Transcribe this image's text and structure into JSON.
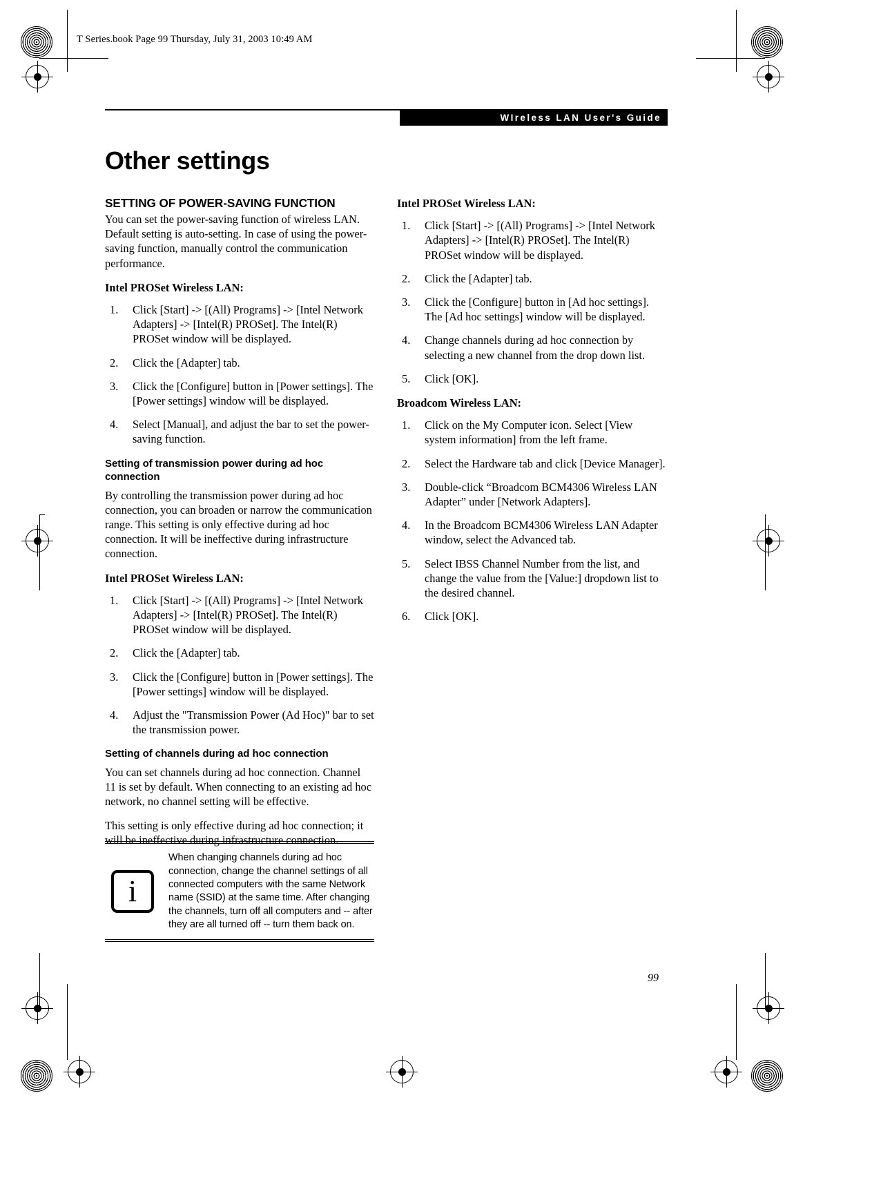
{
  "file_stamp": "T Series.book  Page 99  Thursday, July 31, 2003  10:49 AM",
  "running_head": "WIreless LAN User's Guide",
  "page_title": "Other settings",
  "folio": "99",
  "note": {
    "icon_glyph": "i",
    "text": "When changing channels during ad hoc connection, change the channel settings of all connected computers with the same Network name (SSID) at the same time. After changing the channels, turn off all computers and -- after they are all turned off -- turn them back on."
  },
  "left_column": {
    "section_heading": "SETTING OF POWER-SAVING FUNCTION",
    "intro": "You can set the power-saving function of wireless LAN. Default setting is auto-setting. In case of using the power-saving function, manually control the communication performance.",
    "lead_in_1": "Intel PROSet Wireless LAN:",
    "steps_1": [
      {
        "num": "1.",
        "text": "Click [Start] -> [(All) Programs] -> [Intel Network Adapters] -> [Intel(R) PROSet]. The Intel(R) PROSet window will be displayed."
      },
      {
        "num": "2.",
        "text": "Click the [Adapter] tab."
      },
      {
        "num": "3.",
        "text": "Click the [Configure] button in [Power settings]. The [Power settings] window will be displayed."
      },
      {
        "num": "4.",
        "text": "Select [Manual], and adjust the bar to set the power-saving function."
      }
    ],
    "sub_heading_1": "Setting of transmission power during ad hoc connection",
    "para_1": "By controlling the transmission power during ad hoc connection, you can broaden or narrow the communication range. This setting is only effective during ad hoc connection. It will be ineffective during infrastructure connection.",
    "lead_in_2": "Intel PROSet Wireless LAN:",
    "steps_2": [
      {
        "num": "1.",
        "text": "Click [Start] -> [(All) Programs] -> [Intel Network Adapters] -> [Intel(R) PROSet]. The Intel(R) PROSet window will be displayed."
      },
      {
        "num": "2.",
        "text": "Click the [Adapter] tab."
      },
      {
        "num": "3.",
        "text": "Click the [Configure] button in [Power settings]. The [Power settings] window will be displayed."
      },
      {
        "num": "4.",
        "text": "Adjust the \"Transmission Power (Ad Hoc)\" bar to set the transmission power."
      }
    ],
    "sub_heading_2": "Setting of channels during ad hoc connection",
    "para_2": "You can set channels during ad hoc connection. Channel 11 is set by default. When connecting to an existing ad hoc network, no channel setting will be effective.",
    "para_3": "This setting is only effective during ad hoc connection; it will be ineffective during infrastructure connection."
  },
  "right_column": {
    "lead_in_1": "Intel PROSet Wireless LAN:",
    "steps_1": [
      {
        "num": "1.",
        "text": "Click [Start] -> [(All) Programs] -> [Intel Network Adapters] -> [Intel(R) PROSet]. The Intel(R) PROSet window will be displayed."
      },
      {
        "num": "2.",
        "text": "Click the [Adapter] tab."
      },
      {
        "num": "3.",
        "text": "Click the [Configure] button in [Ad hoc settings]. The [Ad hoc settings] window will be displayed."
      },
      {
        "num": "4.",
        "text": "Change channels during ad hoc connection by selecting a new channel from the drop down list."
      },
      {
        "num": "5.",
        "text": "Click [OK]."
      }
    ],
    "lead_in_2": "Broadcom Wireless LAN:",
    "steps_2": [
      {
        "num": "1.",
        "text": "Click on the My Computer icon. Select [View system information] from the left frame."
      },
      {
        "num": "2.",
        "text": "Select the Hardware tab and click [Device Manager]."
      },
      {
        "num": "3.",
        "text": "Double-click “Broadcom BCM4306 Wireless LAN Adapter” under [Network Adapters]."
      },
      {
        "num": "4.",
        "text": "In the Broadcom BCM4306 Wireless LAN Adapter window, select the Advanced tab."
      },
      {
        "num": "5.",
        "text": "Select IBSS Channel Number from the list, and change the value from the [Value:] dropdown list to the desired channel."
      },
      {
        "num": "6.",
        "text": "Click [OK]."
      }
    ]
  }
}
